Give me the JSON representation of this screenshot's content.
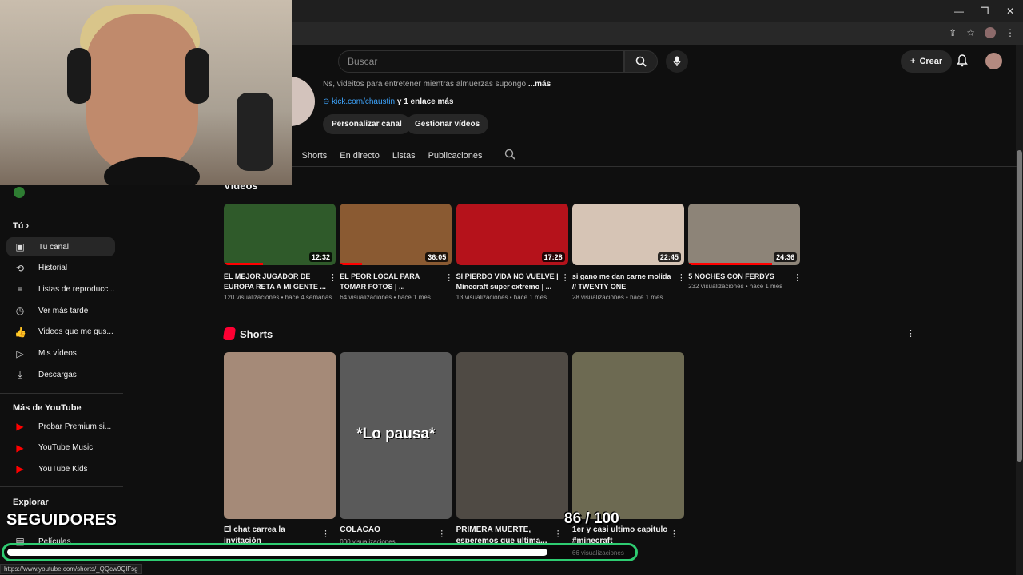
{
  "browser": {
    "min": "—",
    "max": "❐",
    "close": "✕",
    "cast": "⇪",
    "star": "☆",
    "menu": "⋮"
  },
  "header": {
    "search_placeholder": "Buscar",
    "create_label": "Crear"
  },
  "channel": {
    "description": "Ns, videitos para entretener mientras almuerzas supongo",
    "more": "...más",
    "link": "kick.com/chaustin",
    "link_more": "y 1 enlace más",
    "btn_customize": "Personalizar canal",
    "btn_manage": "Gestionar vídeos"
  },
  "tabs": [
    "s",
    "Shorts",
    "En directo",
    "Listas",
    "Publicaciones"
  ],
  "sidebar": {
    "you_label": "Tú",
    "you_items": [
      {
        "label": "Tu canal",
        "icon": "channel-icon",
        "glyph": "▣",
        "active": true
      },
      {
        "label": "Historial",
        "icon": "history-icon",
        "glyph": "⟲"
      },
      {
        "label": "Listas de reproducc...",
        "icon": "playlist-icon",
        "glyph": "≡"
      },
      {
        "label": "Ver más tarde",
        "icon": "clock-icon",
        "glyph": "◷"
      },
      {
        "label": "Videos que me gus...",
        "icon": "thumbs-up-icon",
        "glyph": "👍"
      },
      {
        "label": "Mis vídeos",
        "icon": "my-videos-icon",
        "glyph": "▷"
      },
      {
        "label": "Descargas",
        "icon": "download-icon",
        "glyph": "⤓"
      }
    ],
    "more_label": "Más de YouTube",
    "more_items": [
      {
        "label": "Probar Premium si...",
        "icon": "youtube-premium-icon"
      },
      {
        "label": "YouTube Music",
        "icon": "youtube-music-icon"
      },
      {
        "label": "YouTube Kids",
        "icon": "youtube-kids-icon"
      }
    ],
    "explore_label": "Explorar",
    "explore_partial": "Películas"
  },
  "videos_section": "Vídeos",
  "videos": [
    {
      "title": "EL MEJOR JUGADOR DE EUROPA RETA A MI GENTE ...",
      "meta": "120 visualizaciones • hace 4 semanas",
      "duration": "12:32",
      "watched": 0.35,
      "bg": "#2f5a2a"
    },
    {
      "title": "EL PEOR LOCAL PARA TOMAR FOTOS | ...",
      "meta": "64 visualizaciones • hace 1 mes",
      "duration": "36:05",
      "watched": 0.2,
      "bg": "#8a5a32"
    },
    {
      "title": "SI PIERDO VIDA NO VUELVE | Minecraft super extremo | ...",
      "meta": "13 visualizaciones • hace 1 mes",
      "duration": "17:28",
      "watched": 0.0,
      "bg": "#b5121b"
    },
    {
      "title": "si gano me dan carne molida // TWENTY ONE",
      "meta": "28 visualizaciones • hace 1 mes",
      "duration": "22:45",
      "watched": 0.0,
      "bg": "#d6c4b5"
    },
    {
      "title": "5 NOCHES CON FERDYS",
      "meta": "232 visualizaciones • hace 1 mes",
      "duration": "24:36",
      "watched": 0.75,
      "bg": "#8d8478"
    }
  ],
  "shorts_section": "Shorts",
  "shorts": [
    {
      "title": "El chat carrea la invitación",
      "meta": "",
      "bg": "#a58a78"
    },
    {
      "title": "COLACAO",
      "meta": "000 visualizaciones",
      "bg": "#5a5a5a",
      "overlay": "*Lo pausa*"
    },
    {
      "title": "PRIMERA MUERTE, esperemos que ultima...",
      "meta": "",
      "bg": "#4f4a44"
    },
    {
      "title": "1er y casi ultimo capitulo #minecraft",
      "meta": "66 visualizaciones",
      "bg": "#6d6a52"
    }
  ],
  "overlay": {
    "label": "SEGUIDORES",
    "count": "86 / 100",
    "progress": 0.86
  },
  "status_url": "https://www.youtube.com/shorts/_QQcw9QlFsg"
}
